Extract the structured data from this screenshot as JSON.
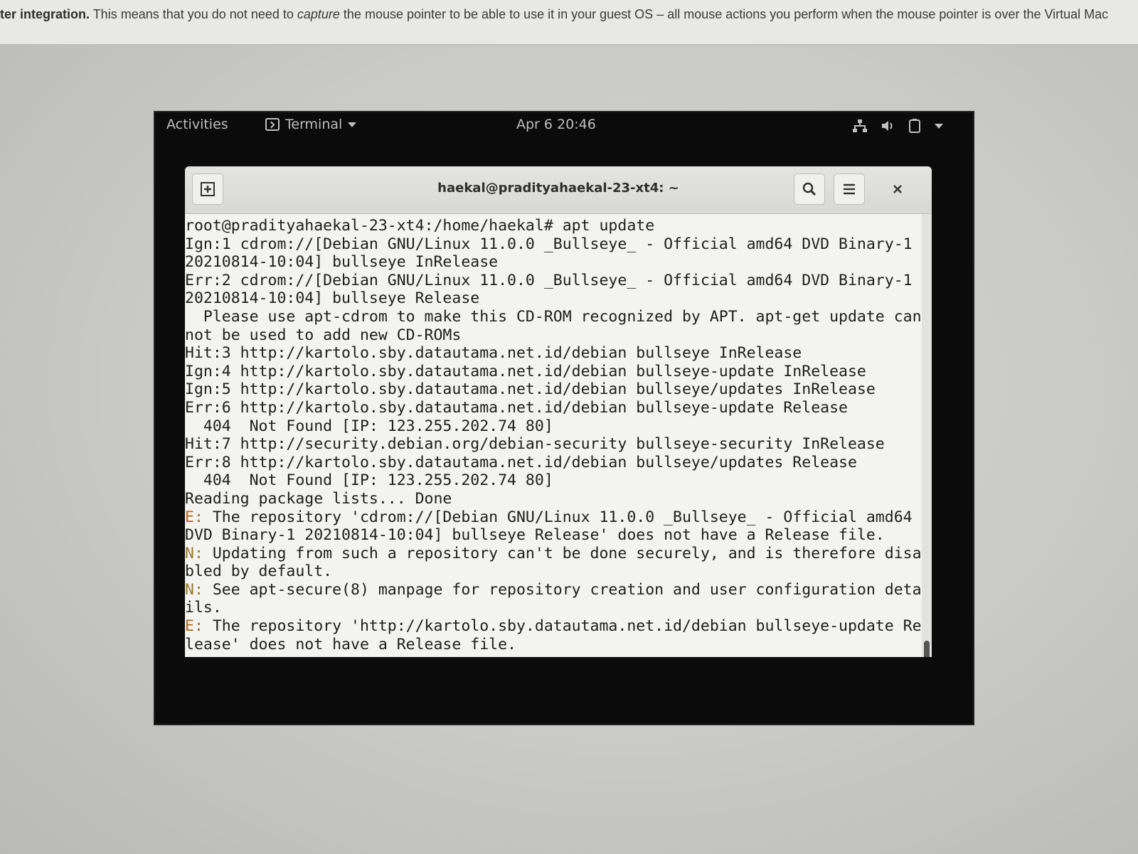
{
  "host": {
    "banner_bold": "ter integration.",
    "banner_text1": " This means that you do not need to ",
    "banner_italic": "capture",
    "banner_text2": " the mouse pointer to be able to use it in your guest OS – all mouse actions you perform when the mouse pointer is over the Virtual Mac"
  },
  "top_bar": {
    "activities": "Activities",
    "app_menu": "Terminal",
    "clock": "Apr 6  20:46",
    "icons": [
      "network-icon",
      "volume-icon",
      "power-icon",
      "chevron-down-icon"
    ]
  },
  "window": {
    "title": "haekal@pradityahaekal-23-xt4: ~",
    "buttons": [
      "new-tab-icon",
      "search-icon",
      "hamburger-menu-icon",
      "close-icon"
    ]
  },
  "terminal": {
    "lines": [
      {
        "prefix": "",
        "text": "root@pradityahaekal-23-xt4:/home/haekal# apt update"
      },
      {
        "prefix": "",
        "text": "Ign:1 cdrom://[Debian GNU/Linux 11.0.0 _Bullseye_ - Official amd64 DVD Binary-1"
      },
      {
        "prefix": "",
        "text": "20210814-10:04] bullseye InRelease"
      },
      {
        "prefix": "",
        "text": "Err:2 cdrom://[Debian GNU/Linux 11.0.0 _Bullseye_ - Official amd64 DVD Binary-1"
      },
      {
        "prefix": "",
        "text": "20210814-10:04] bullseye Release"
      },
      {
        "prefix": "",
        "text": "  Please use apt-cdrom to make this CD-ROM recognized by APT. apt-get update can"
      },
      {
        "prefix": "",
        "text": "not be used to add new CD-ROMs"
      },
      {
        "prefix": "",
        "text": "Hit:3 http://kartolo.sby.datautama.net.id/debian bullseye InRelease"
      },
      {
        "prefix": "",
        "text": "Ign:4 http://kartolo.sby.datautama.net.id/debian bullseye-update InRelease"
      },
      {
        "prefix": "",
        "text": "Ign:5 http://kartolo.sby.datautama.net.id/debian bullseye/updates InRelease"
      },
      {
        "prefix": "",
        "text": "Err:6 http://kartolo.sby.datautama.net.id/debian bullseye-update Release"
      },
      {
        "prefix": "",
        "text": "  404  Not Found [IP: 123.255.202.74 80]"
      },
      {
        "prefix": "",
        "text": "Hit:7 http://security.debian.org/debian-security bullseye-security InRelease"
      },
      {
        "prefix": "",
        "text": "Err:8 http://kartolo.sby.datautama.net.id/debian bullseye/updates Release"
      },
      {
        "prefix": "",
        "text": "  404  Not Found [IP: 123.255.202.74 80]"
      },
      {
        "prefix": "",
        "text": "Reading package lists... Done"
      },
      {
        "prefix": "E:",
        "text": " The repository 'cdrom://[Debian GNU/Linux 11.0.0 _Bullseye_ - Official amd64"
      },
      {
        "prefix": "",
        "text": "DVD Binary-1 20210814-10:04] bullseye Release' does not have a Release file."
      },
      {
        "prefix": "N:",
        "text": " Updating from such a repository can't be done securely, and is therefore disa"
      },
      {
        "prefix": "",
        "text": "bled by default."
      },
      {
        "prefix": "N:",
        "text": " See apt-secure(8) manpage for repository creation and user configuration deta"
      },
      {
        "prefix": "",
        "text": "ils."
      },
      {
        "prefix": "E:",
        "text": " The repository 'http://kartolo.sby.datautama.net.id/debian bullseye-update Re"
      },
      {
        "prefix": "",
        "text": "lease' does not have a Release file."
      }
    ]
  },
  "colors": {
    "error_prefix": "#b5651d",
    "notice_prefix": "#9a7a2a",
    "vm_background": "#0b0b0c"
  }
}
